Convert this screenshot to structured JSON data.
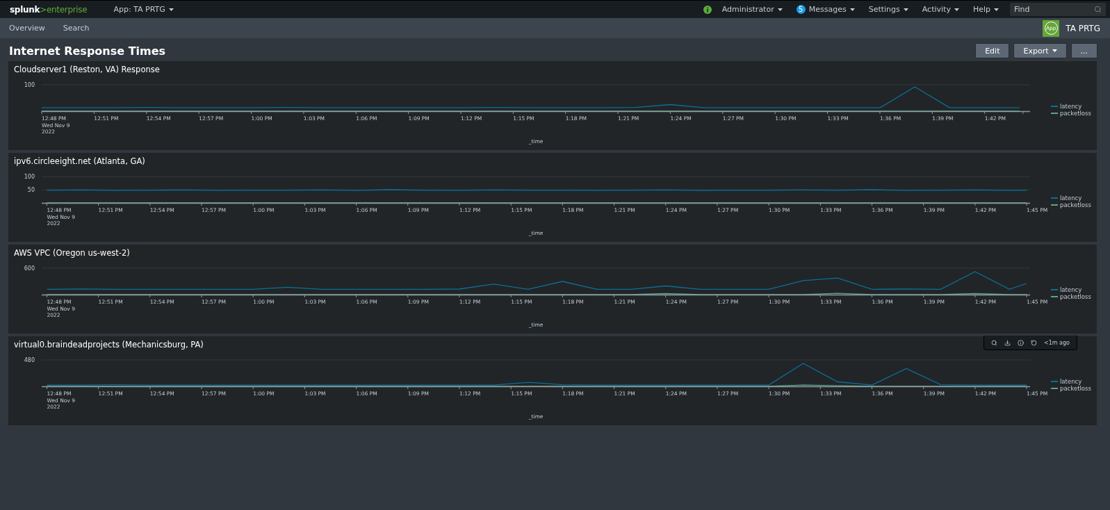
{
  "topbar": {
    "logo_main": "splunk",
    "logo_accent": ">enterprise",
    "app_menu": "App: TA PRTG",
    "menus": [
      {
        "label": "Administrator",
        "kind": "status"
      },
      {
        "label": "Messages",
        "kind": "count",
        "count": "5"
      },
      {
        "label": "Settings",
        "kind": "plain"
      },
      {
        "label": "Activity",
        "kind": "plain"
      },
      {
        "label": "Help",
        "kind": "plain"
      }
    ],
    "search": {
      "placeholder": "Find"
    }
  },
  "nav": {
    "items": [
      {
        "label": "Overview"
      },
      {
        "label": "Search"
      }
    ],
    "app_badge": "App",
    "app_name": "TA PRTG"
  },
  "dashboard": {
    "title": "Internet Response Times",
    "buttons": [
      {
        "label": "Edit",
        "kind": "plain"
      },
      {
        "label": "Export",
        "kind": "dropdown"
      },
      {
        "label": "...",
        "kind": "plain"
      }
    ]
  },
  "panels": [
    {
      "title": "Cloudserver1 (Reston, VA) Response",
      "y_ticks": [
        "100"
      ],
      "x_ticks": [
        "12:48 PM",
        "12:51 PM",
        "12:54 PM",
        "12:57 PM",
        "1:00 PM",
        "1:03 PM",
        "1:06 PM",
        "1:09 PM",
        "1:12 PM",
        "1:15 PM",
        "1:18 PM",
        "1:21 PM",
        "1:24 PM",
        "1:27 PM",
        "1:30 PM",
        "1:33 PM",
        "1:36 PM",
        "1:39 PM",
        "1:42 PM"
      ],
      "date_lines": [
        "Wed Nov 9",
        "2022"
      ],
      "x_axis_title": "_time",
      "legend": [
        {
          "name": "latency",
          "color": "#0e6e99"
        },
        {
          "name": "packetloss",
          "color": "#5aa58a"
        }
      ]
    },
    {
      "title": "ipv6.circleeight.net (Atlanta, GA)",
      "y_ticks": [
        "100",
        "50"
      ],
      "x_ticks": [
        "12:48 PM",
        "12:51 PM",
        "12:54 PM",
        "12:57 PM",
        "1:00 PM",
        "1:03 PM",
        "1:06 PM",
        "1:09 PM",
        "1:12 PM",
        "1:15 PM",
        "1:18 PM",
        "1:21 PM",
        "1:24 PM",
        "1:27 PM",
        "1:30 PM",
        "1:33 PM",
        "1:36 PM",
        "1:39 PM",
        "1:42 PM",
        "1:45 PM"
      ],
      "date_lines": [
        "Wed Nov 9",
        "2022"
      ],
      "x_axis_title": "_time",
      "legend": [
        {
          "name": "latency",
          "color": "#0e6e99"
        },
        {
          "name": "packetloss",
          "color": "#5aa58a"
        }
      ]
    },
    {
      "title": "AWS VPC (Oregon us-west-2)",
      "y_ticks": [
        "600"
      ],
      "x_ticks": [
        "12:48 PM",
        "12:51 PM",
        "12:54 PM",
        "12:57 PM",
        "1:00 PM",
        "1:03 PM",
        "1:06 PM",
        "1:09 PM",
        "1:12 PM",
        "1:15 PM",
        "1:18 PM",
        "1:21 PM",
        "1:24 PM",
        "1:27 PM",
        "1:30 PM",
        "1:33 PM",
        "1:36 PM",
        "1:39 PM",
        "1:42 PM",
        "1:45 PM"
      ],
      "date_lines": [
        "Wed Nov 9",
        "2022"
      ],
      "x_axis_title": "_time",
      "legend": [
        {
          "name": "latency",
          "color": "#0e6e99"
        },
        {
          "name": "packetloss",
          "color": "#5aa58a"
        }
      ]
    },
    {
      "title": "virtual0.braindeadprojects (Mechanicsburg, PA)",
      "y_ticks": [
        "480"
      ],
      "toolbar": {
        "time": "<1m ago"
      },
      "x_ticks": [
        "12:48 PM",
        "12:51 PM",
        "12:54 PM",
        "12:57 PM",
        "1:00 PM",
        "1:03 PM",
        "1:06 PM",
        "1:09 PM",
        "1:12 PM",
        "1:15 PM",
        "1:18 PM",
        "1:21 PM",
        "1:24 PM",
        "1:27 PM",
        "1:30 PM",
        "1:33 PM",
        "1:36 PM",
        "1:39 PM",
        "1:42 PM",
        "1:45 PM"
      ],
      "date_lines": [
        "Wed Nov 9",
        "2022"
      ],
      "x_axis_title": "_time",
      "legend": [
        {
          "name": "latency",
          "color": "#0e6e99"
        },
        {
          "name": "packetloss",
          "color": "#5aa58a"
        }
      ]
    }
  ]
}
